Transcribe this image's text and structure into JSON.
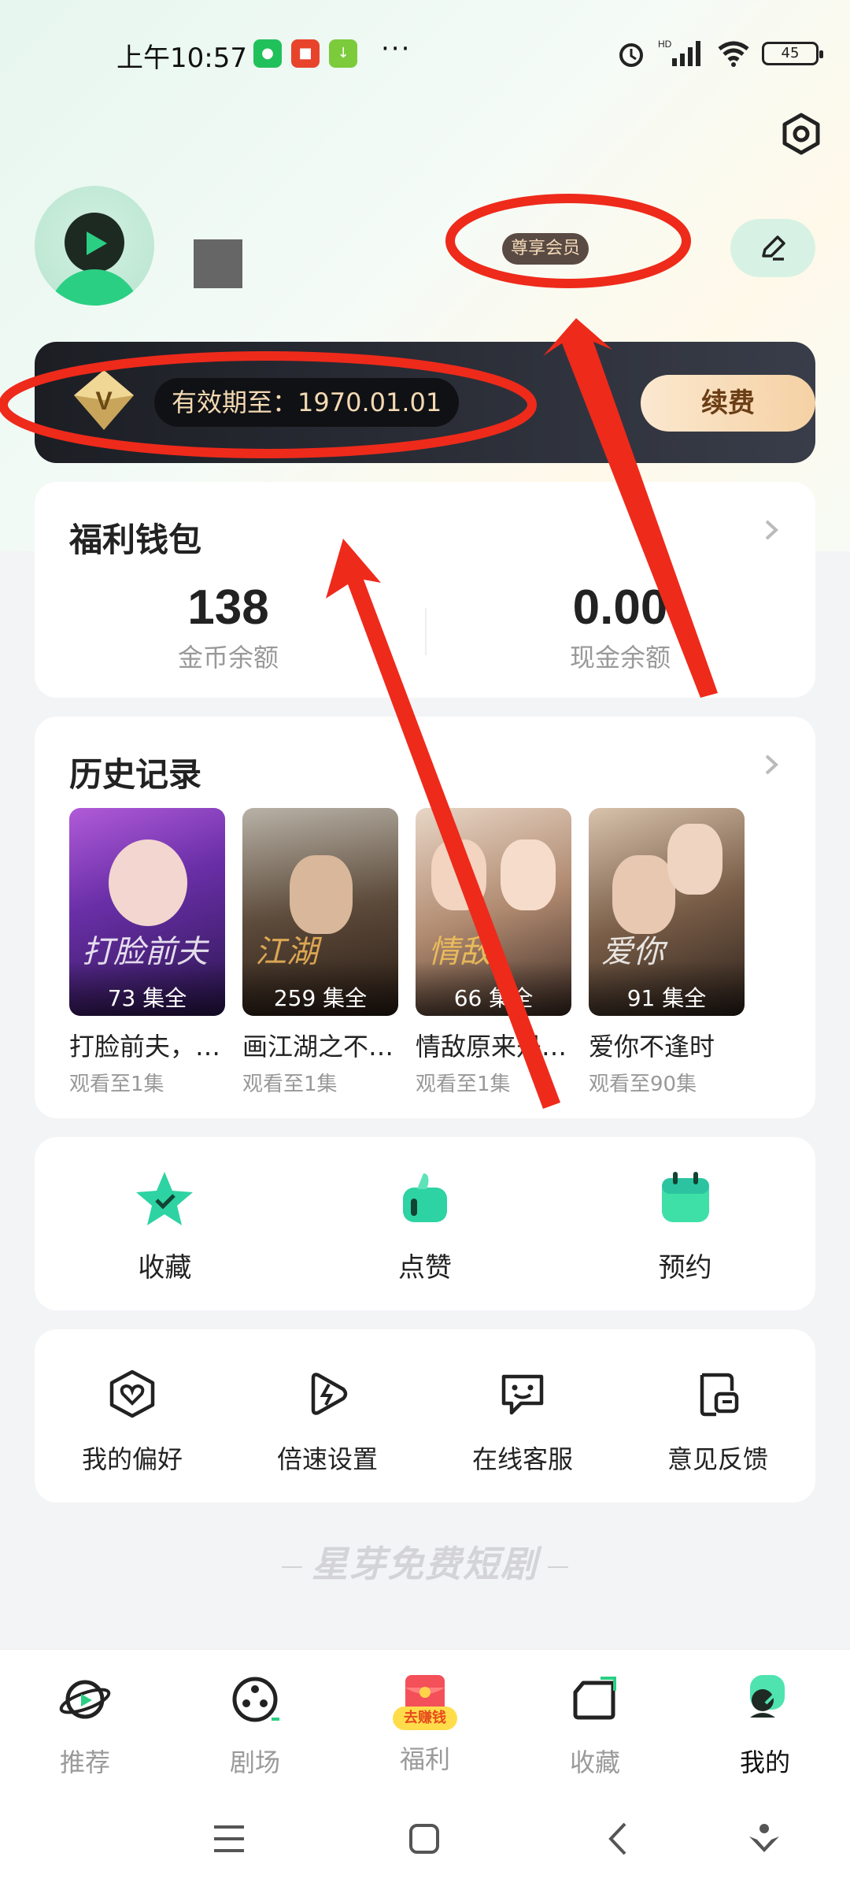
{
  "status_bar": {
    "time": "上午10:57",
    "battery": "45",
    "network": "HD"
  },
  "profile": {
    "vip_tag": "尊享会员"
  },
  "vip_bar": {
    "expire_text": "有效期至：1970.01.01",
    "renew_label": "续费"
  },
  "wallet": {
    "title": "福利钱包",
    "coins": {
      "value": "138",
      "label": "金币余额"
    },
    "cash": {
      "value": "0.00",
      "label": "现金余额"
    }
  },
  "history": {
    "title": "历史记录",
    "items": [
      {
        "name": "打脸前夫，离婚后我成为",
        "episodes": "73 集全",
        "progress": "观看至1集",
        "poster_text": "打脸前夫"
      },
      {
        "name": "画江湖之不良人",
        "episodes": "259 集全",
        "progress": "观看至1集",
        "poster_text": "江湖"
      },
      {
        "name": "情敌原来是我的",
        "episodes": "66 集全",
        "progress": "观看至1集",
        "poster_text": "情敌"
      },
      {
        "name": "爱你不逢时",
        "episodes": "91 集全",
        "progress": "观看至90集",
        "poster_text": "爱你"
      }
    ]
  },
  "quick_actions": [
    {
      "label": "收藏",
      "icon": "star-icon"
    },
    {
      "label": "点赞",
      "icon": "thumb-icon"
    },
    {
      "label": "预约",
      "icon": "calendar-icon"
    }
  ],
  "tools": [
    {
      "label": "我的偏好",
      "icon": "heart-shield-icon"
    },
    {
      "label": "倍速设置",
      "icon": "speed-icon"
    },
    {
      "label": "在线客服",
      "icon": "chat-icon"
    },
    {
      "label": "意见反馈",
      "icon": "feedback-icon"
    }
  ],
  "footer_brand": "星芽免费短剧",
  "tabs": [
    {
      "label": "推荐",
      "icon": "planet-icon",
      "active": false
    },
    {
      "label": "剧场",
      "icon": "film-reel-icon",
      "active": false
    },
    {
      "label": "福利",
      "icon": "red-envelope-icon",
      "badge": "去赚钱",
      "active": false
    },
    {
      "label": "收藏",
      "icon": "folder-icon",
      "active": false
    },
    {
      "label": "我的",
      "icon": "me-icon",
      "active": true
    }
  ],
  "colors": {
    "accent_green": "#2bcf84",
    "vip_gold": "#f4d9b2",
    "annotation_red": "#ee2a1b"
  }
}
